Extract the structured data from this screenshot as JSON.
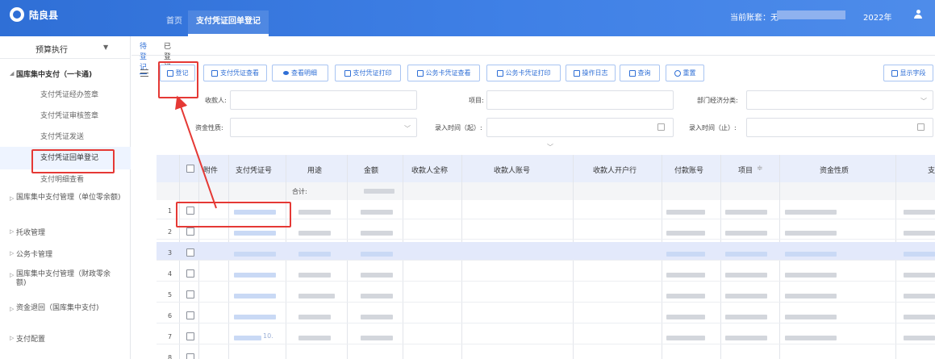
{
  "header": {
    "app_title": "陆良县",
    "nav_home": "首页",
    "active_tab": "支付凭证回单登记",
    "account_label": "当前账套：无",
    "year": "2022年"
  },
  "sidebar": {
    "dropdown_label": "预算执行",
    "groups": [
      {
        "label": "国库集中支付（一卡通)",
        "expanded": true
      },
      {
        "label": "国库集中支付管理（单位零余额)"
      },
      {
        "label": "托收管理"
      },
      {
        "label": "公务卡管理"
      },
      {
        "label": "国库集中支付管理（财政零余额)"
      },
      {
        "label": "资金退回（国库集中支付)"
      },
      {
        "label": "支付配置"
      }
    ],
    "subitems": [
      "支付凭证经办签章",
      "支付凭证审核签章",
      "支付凭证发送",
      "支付凭证回单登记",
      "支付明细查看"
    ],
    "active_subitem": "支付凭证回单登记"
  },
  "tabs": {
    "pending": "待登记",
    "done": "已登记"
  },
  "toolbar": {
    "register": "登记",
    "voucher_view": "支付凭证查看",
    "detail_view": "查看明细",
    "voucher_print": "支付凭证打印",
    "card_voucher_view": "公务卡凭证查看",
    "card_voucher_print": "公务卡凭证打印",
    "op_log": "操作日志",
    "query": "查询",
    "reset": "重置",
    "show_fields": "显示字段"
  },
  "filters": {
    "payee": "收款人:",
    "project": "项目:",
    "dept_econ": "部门经济分类:",
    "fund_nature": "资金性质:",
    "entry_from": "录入时间（起）:",
    "entry_to": "录入时间（止）:"
  },
  "table": {
    "columns": [
      "附件",
      "支付凭证号",
      "用途",
      "金额",
      "收款人全称",
      "收款人账号",
      "收款人开户行",
      "付款账号",
      "项目",
      "资金性质",
      "支"
    ],
    "sum_label": "合计:",
    "row_numbers": [
      "1",
      "2",
      "3",
      "4",
      "5",
      "6",
      "7",
      "8"
    ],
    "row_fragment": "10."
  },
  "colors": {
    "brand": "#2f6fd6",
    "annotation": "#e53935",
    "highlight_row": "#e3e9fb"
  }
}
